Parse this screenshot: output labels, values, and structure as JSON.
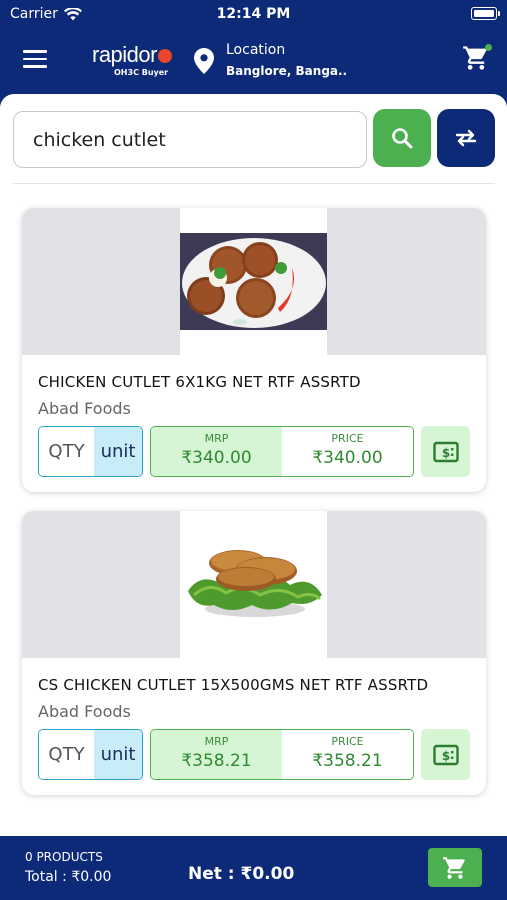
{
  "status_bar": {
    "carrier": "Carrier",
    "time": "12:14 PM"
  },
  "header": {
    "logo_text": "rapidor",
    "logo_subtext": "OH3C Buyer",
    "location_title": "Location",
    "location_value": "Banglore, Banga.."
  },
  "search": {
    "value": "chicken cutlet",
    "placeholder": ""
  },
  "products": [
    {
      "name": "CHICKEN CUTLET 6X1KG NET RTF ASSRTD",
      "vendor": "Abad Foods",
      "qty_label": "QTY",
      "unit_label": "unit",
      "mrp_label": "MRP",
      "mrp": "₹340.00",
      "price_label": "PRICE",
      "price": "₹340.00"
    },
    {
      "name": "CS CHICKEN CUTLET 15X500GMS NET RTF ASSRTD",
      "vendor": "Abad Foods",
      "qty_label": "QTY",
      "unit_label": "unit",
      "mrp_label": "MRP",
      "mrp": "₹358.21",
      "price_label": "PRICE",
      "price": "₹358.21"
    }
  ],
  "footer": {
    "products_count": "0 PRODUCTS",
    "total": "Total : ₹0.00",
    "net": "Net : ₹0.00"
  },
  "colors": {
    "primary": "#0d2a78",
    "accent_green": "#4caf50",
    "light_green": "#d6f5d4",
    "qty_border": "#2aa2c8",
    "unit_bg": "#c9ecf9",
    "image_bg": "#e1e2e6"
  },
  "icons": {
    "wifi": "wifi-icon",
    "battery": "battery-icon",
    "menu": "hamburger-menu-icon",
    "location": "location-pin-icon",
    "cart": "shopping-cart-icon",
    "search": "search-icon",
    "swap": "swap-arrows-icon",
    "quote": "dollar-bill-icon"
  }
}
